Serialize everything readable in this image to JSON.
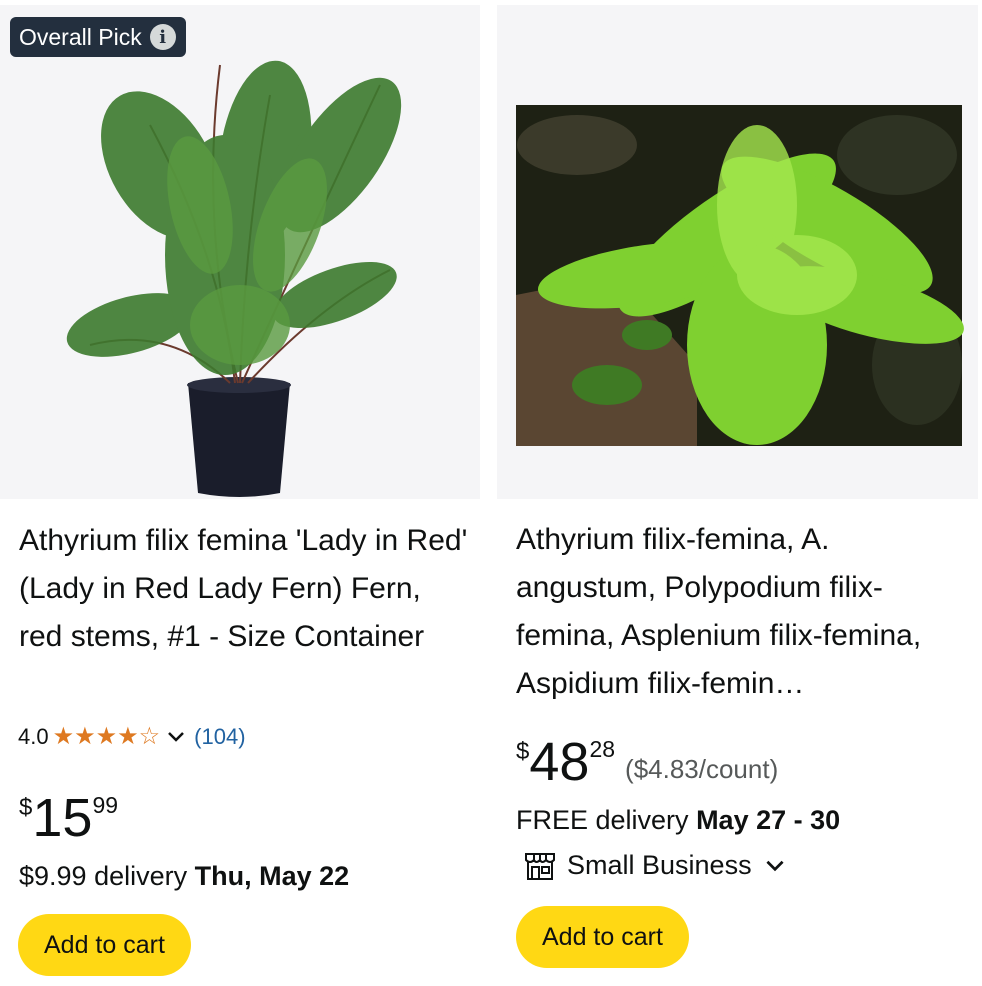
{
  "products": [
    {
      "badge": "Overall Pick",
      "title": "Athyrium filix femina 'Lady in Red' (Lady in Red Lady Fern) Fern, red stems, #1 - Size Container",
      "rating": "4.0",
      "stars": 4,
      "rating_count": "(104)",
      "price_symbol": "$",
      "price_whole": "15",
      "price_fraction": "99",
      "delivery_prefix": "$9.99 delivery",
      "delivery_date": "Thu, May 22",
      "button_label": "Add to cart"
    },
    {
      "title": "Athyrium filix-femina, A. angustum, Polypodium filix-femina, Asplenium filix-femina, Aspidium filix-femin…",
      "price_symbol": "$",
      "price_whole": "48",
      "price_fraction": "28",
      "unit_price": "($4.83/count)",
      "delivery_prefix": "FREE delivery",
      "delivery_date": "May 27 - 30",
      "small_business": "Small Business",
      "button_label": "Add to cart"
    }
  ],
  "colors": {
    "badge_bg": "#232f3e",
    "star": "#de7921",
    "link": "#2162a1",
    "button": "#ffd814"
  }
}
